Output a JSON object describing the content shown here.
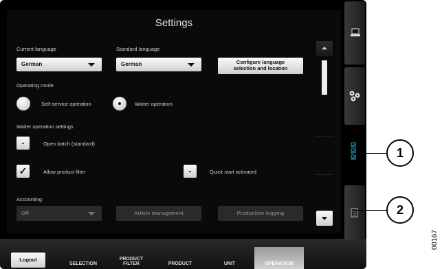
{
  "settings": {
    "title": "Settings",
    "current_language": {
      "label": "Current language",
      "value": "German"
    },
    "standard_language": {
      "label": "Standard language",
      "value": "German"
    },
    "configure_button": {
      "line1": "Configure language",
      "line2": "selection and location"
    },
    "operating_mode": {
      "label": "Operating mode",
      "options": [
        "Self-service operation",
        "Waiter operation"
      ],
      "selected": "Waiter operation"
    },
    "waiter_settings": {
      "label": "Waiter operation settings",
      "open_batch": {
        "label": "Open batch (standard)",
        "state": "-"
      },
      "allow_product_filter": {
        "label": "Allow product filter",
        "state": "✓"
      },
      "quick_start": {
        "label": "Quick start activated",
        "state": "-"
      }
    },
    "accounting": {
      "label": "Accounting",
      "value": "Off",
      "buttons": [
        "Article management",
        "Production logging"
      ]
    }
  },
  "bottom_bar": {
    "logout": "Logout",
    "tabs": [
      {
        "label": "SELECTION"
      },
      {
        "line1": "PRODUCT",
        "line2": "FILTER"
      },
      {
        "label": "PRODUCT"
      },
      {
        "label": "UNIT"
      },
      {
        "label": "OPERATION"
      }
    ],
    "active_tab": "OPERATION"
  },
  "side_tabs": [
    "laptop-icon",
    "units-icon",
    "checklist-icon",
    "document-icon"
  ],
  "active_side_tab": "checklist-icon",
  "callouts": [
    "1",
    "2"
  ],
  "document_id": "00167"
}
